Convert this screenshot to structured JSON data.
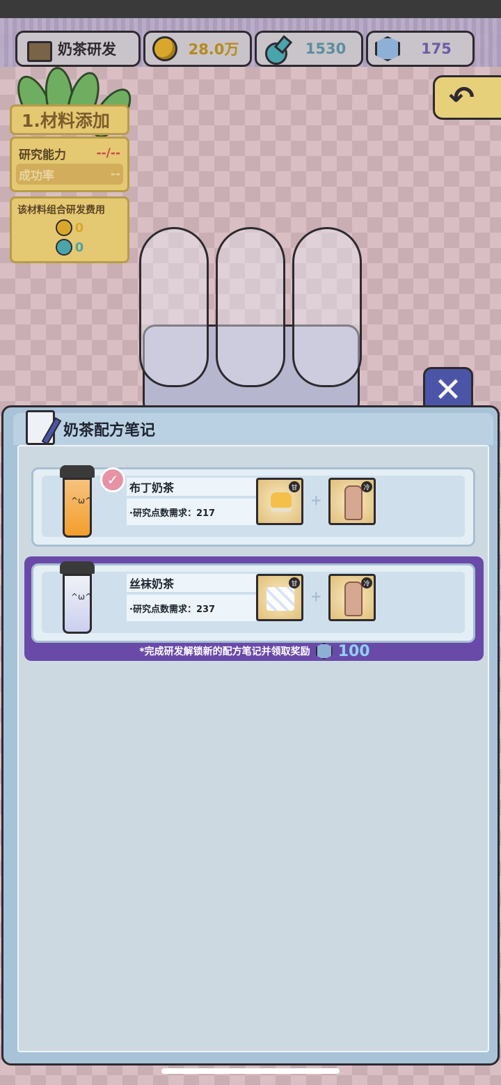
{
  "topbar": {
    "title": "奶茶研发",
    "coins": "28.0万",
    "research_points": "1530",
    "gems": "175"
  },
  "left_panel": {
    "title": "1.材料添加",
    "ability_label": "研究能力",
    "ability_value": "--/--",
    "success_label": "成功率",
    "success_value": "--",
    "cost_label": "该材料组合研发费用",
    "cost_coins": "0",
    "cost_points": "0"
  },
  "dialog": {
    "title": "奶茶配方笔记",
    "close": "✕",
    "recipes": [
      {
        "name": "布丁奶茶",
        "requirement": "·研究点数需求：217",
        "completed": true,
        "ing1_tag": "甘",
        "ing2_tag": "冷"
      },
      {
        "name": "丝袜奶茶",
        "requirement": "·研究点数需求：237",
        "completed": false,
        "ing1_tag": "甘",
        "ing2_tag": "冷"
      }
    ],
    "reward_text": "*完成研发解锁新的配方笔记并领取奖励",
    "reward_amount": "100"
  },
  "icons": {
    "back": "arrow-back-icon",
    "close": "close-icon",
    "check": "check-icon"
  },
  "colors": {
    "highlight": "#6a4aa8",
    "close_button": "#4b55a8",
    "check_badge": "#e792a5"
  }
}
